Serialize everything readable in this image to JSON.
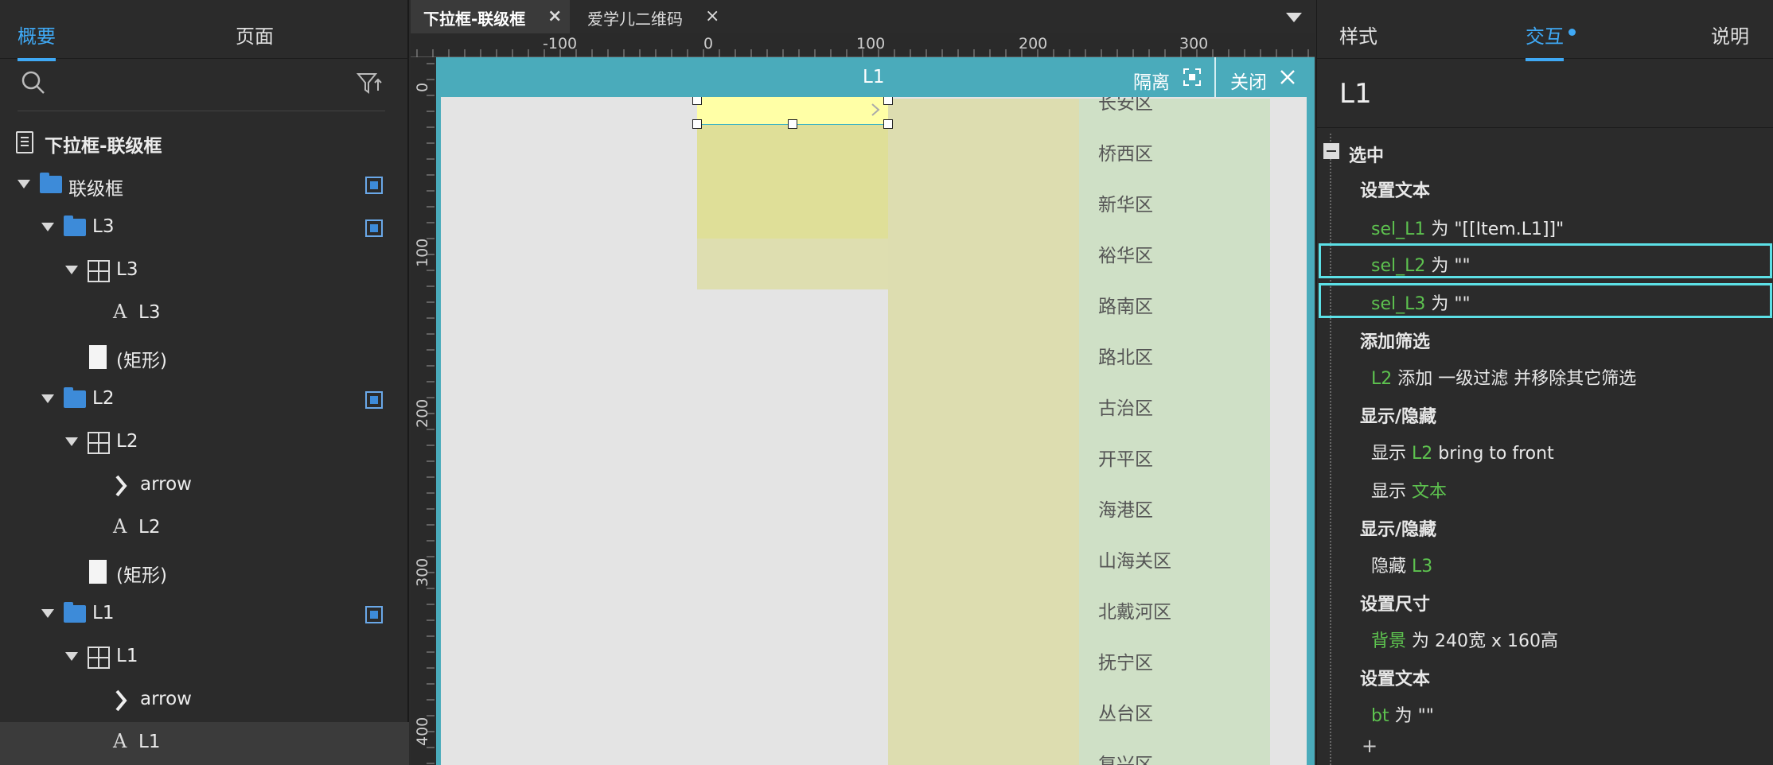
{
  "left_panel": {
    "tabs": [
      "概要",
      "页面"
    ],
    "tree": [
      {
        "label": "下拉框-联级框",
        "icon": "page-icon"
      },
      {
        "label": "联级框",
        "icon": "folder-icon"
      },
      {
        "label": "L3",
        "icon": "folder-icon"
      },
      {
        "label": "L3",
        "icon": "repeater-icon"
      },
      {
        "label": "L3",
        "icon": "text-icon"
      },
      {
        "label": "(矩形)",
        "icon": "rectangle-icon"
      },
      {
        "label": "L2",
        "icon": "folder-icon"
      },
      {
        "label": "L2",
        "icon": "repeater-icon"
      },
      {
        "label": "arrow",
        "icon": "chevron-right-icon"
      },
      {
        "label": "L2",
        "icon": "text-icon"
      },
      {
        "label": "(矩形)",
        "icon": "rectangle-icon"
      },
      {
        "label": "L1",
        "icon": "folder-icon"
      },
      {
        "label": "L1",
        "icon": "repeater-icon"
      },
      {
        "label": "arrow",
        "icon": "chevron-right-icon"
      },
      {
        "label": "L1",
        "icon": "text-icon"
      }
    ]
  },
  "doc_tabs": [
    "下拉框-联级框",
    "爱学儿二维码"
  ],
  "ruler": {
    "h_labels": [
      "-100",
      "0",
      "100",
      "200",
      "300"
    ],
    "v_labels": [
      "0",
      "100",
      "200",
      "300",
      "400"
    ]
  },
  "canvas": {
    "title": "L1",
    "isolate_label": "隔离",
    "close_label": "关闭",
    "districts": [
      "长安区",
      "桥西区",
      "新华区",
      "裕华区",
      "路南区",
      "路北区",
      "古治区",
      "开平区",
      "海港区",
      "山海关区",
      "北戴河区",
      "抚宁区",
      "丛台区",
      "复兴区"
    ]
  },
  "right_panel": {
    "tabs": [
      "样式",
      "交互",
      "说明"
    ],
    "widget_name": "L1",
    "event": "选中",
    "actions": {
      "a1_head": "设置文本",
      "a1_r1_target": "sel_L1",
      "a1_r1_rest": " 为 \"[[Item.L1]]\"",
      "a1_r2_target": "sel_L2",
      "a1_r2_rest": " 为 \"\"",
      "a1_r3_target": "sel_L3",
      "a1_r3_rest": " 为 \"\"",
      "a2_head": "添加筛选",
      "a2_r1_target": "L2",
      "a2_r1_rest": " 添加 一级过滤 并移除其它筛选",
      "a3_head": "显示/隐藏",
      "a3_r1_pre": "显示 ",
      "a3_r1_target": "L2",
      "a3_r1_rest": "  bring to front",
      "a3_r2_pre": "显示 ",
      "a3_r2_target": "文本",
      "a4_head": "显示/隐藏",
      "a4_r1_pre": "隐藏 ",
      "a4_r1_target": "L3",
      "a5_head": "设置尺寸",
      "a5_r1_target": "背景",
      "a5_r1_rest": " 为 240宽 x 160高",
      "a6_head": "设置文本",
      "a6_r1_target": "bt",
      "a6_r1_rest": " 为 \"\"",
      "add": "+"
    }
  },
  "colors": {
    "accent": "#3fa9f5",
    "teal": "#4aabbb",
    "green_target": "#5dc24f",
    "highlight": "#5ce0e6"
  }
}
